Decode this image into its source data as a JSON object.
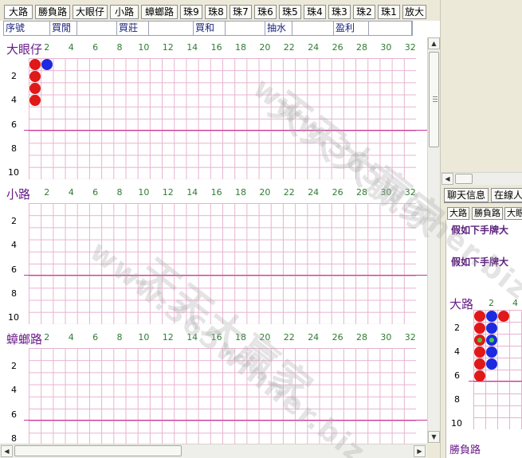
{
  "tabs": [
    {
      "label": "大路",
      "active": true
    },
    {
      "label": "勝負路"
    },
    {
      "label": "大眼仔"
    },
    {
      "label": "小路"
    },
    {
      "label": "蟑螂路"
    },
    {
      "label": "珠9"
    },
    {
      "label": "珠8"
    },
    {
      "label": "珠7"
    },
    {
      "label": "珠6"
    },
    {
      "label": "珠5"
    },
    {
      "label": "珠4"
    },
    {
      "label": "珠3"
    },
    {
      "label": "珠2"
    },
    {
      "label": "珠1"
    },
    {
      "label": "放大"
    }
  ],
  "columns": [
    "序號",
    "買閒",
    "",
    "買莊",
    "",
    "買和",
    "",
    "抽水",
    "",
    "盈利",
    ""
  ],
  "sections": [
    {
      "title": "大眼仔",
      "xticks": [
        "2",
        "4",
        "6",
        "8",
        "10",
        "12",
        "14",
        "16",
        "18",
        "20",
        "22",
        "24",
        "26",
        "28",
        "30",
        "32"
      ],
      "yticks": [
        "2",
        "4",
        "6",
        "8",
        "10"
      ],
      "beads": [
        {
          "col": 0,
          "row": 0,
          "color": "red"
        },
        {
          "col": 1,
          "row": 0,
          "color": "blue"
        },
        {
          "col": 0,
          "row": 1,
          "color": "red"
        },
        {
          "col": 0,
          "row": 2,
          "color": "red"
        },
        {
          "col": 0,
          "row": 3,
          "color": "red"
        }
      ]
    },
    {
      "title": "小路",
      "xticks": [
        "2",
        "4",
        "6",
        "8",
        "10",
        "12",
        "14",
        "16",
        "18",
        "20",
        "22",
        "24",
        "26",
        "28",
        "30",
        "32"
      ],
      "yticks": [
        "2",
        "4",
        "6",
        "8",
        "10"
      ],
      "beads": []
    },
    {
      "title": "蟑螂路",
      "xticks": [
        "2",
        "4",
        "6",
        "8",
        "10",
        "12",
        "14",
        "16",
        "18",
        "20",
        "22",
        "24",
        "26",
        "28",
        "30",
        "32"
      ],
      "yticks": [
        "2",
        "4",
        "6",
        "8"
      ],
      "beads": []
    }
  ],
  "right_panel": {
    "tabs": [
      "聊天信息",
      "在線人"
    ],
    "subtabs": [
      "大路",
      "勝負路",
      "大眼"
    ],
    "predict_lines": [
      "假如下手牌大",
      "假如下手牌大"
    ],
    "mini_road": {
      "title": "大路",
      "xticks": [
        "2",
        "4"
      ],
      "yticks": [
        "2",
        "4",
        "6",
        "8",
        "10"
      ],
      "beads": [
        {
          "col": 0,
          "row": 0,
          "color": "red"
        },
        {
          "col": 1,
          "row": 0,
          "color": "blue"
        },
        {
          "col": 2,
          "row": 0,
          "color": "red"
        },
        {
          "col": 0,
          "row": 1,
          "color": "red"
        },
        {
          "col": 1,
          "row": 1,
          "color": "blue"
        },
        {
          "col": 0,
          "row": 2,
          "color": "red-tie"
        },
        {
          "col": 1,
          "row": 2,
          "color": "blue-tie"
        },
        {
          "col": 0,
          "row": 3,
          "color": "red"
        },
        {
          "col": 1,
          "row": 3,
          "color": "blue"
        },
        {
          "col": 0,
          "row": 4,
          "color": "red"
        },
        {
          "col": 1,
          "row": 4,
          "color": "blue"
        },
        {
          "col": 0,
          "row": 5,
          "color": "red"
        }
      ],
      "footer_label": "勝負路"
    }
  },
  "watermark": {
    "cn": "天天大贏家",
    "url": "www.365winner.biz"
  },
  "colors": {
    "grid": "#e6b3cf",
    "divider": "#cc3399",
    "title": "#6a1b8a",
    "tick": "#2e7d32",
    "red": "#e01818",
    "blue": "#1c2ae0"
  }
}
